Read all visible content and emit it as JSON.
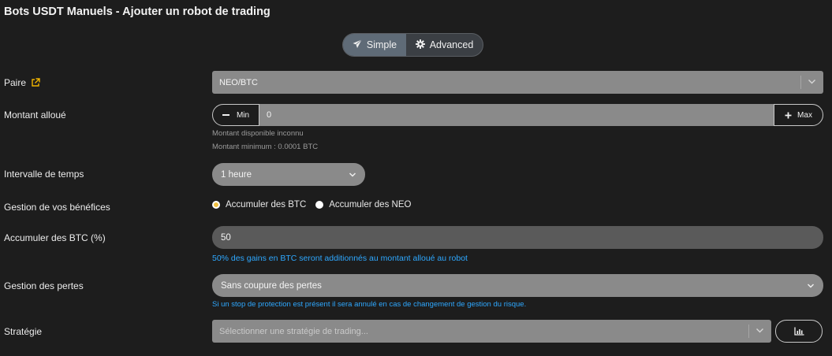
{
  "header": {
    "title": "Bots USDT Manuels - Ajouter un robot de trading"
  },
  "mode_switch": {
    "simple_label": "Simple",
    "advanced_label": "Advanced",
    "active": "simple"
  },
  "pair": {
    "label": "Paire",
    "value": "NEO/BTC"
  },
  "amount": {
    "label": "Montant alloué",
    "min_label": "Min",
    "value": "0",
    "max_label": "Max",
    "available_hint": "Montant disponible inconnu",
    "minimum_hint": "Montant minimum : 0.0001 BTC"
  },
  "interval": {
    "label": "Intervalle de temps",
    "value": "1 heure"
  },
  "profits": {
    "label": "Gestion de vos bénéfices",
    "options": [
      "Accumuler des BTC",
      "Accumuler des NEO"
    ],
    "selected": "Accumuler des BTC"
  },
  "accumulate": {
    "label": "Accumuler des BTC (%)",
    "value": "50",
    "info": "50% des gains en BTC seront additionnés au montant alloué au robot"
  },
  "losses": {
    "label": "Gestion des pertes",
    "value": "Sans coupure des pertes",
    "info": "Si un stop de protection est présent il sera annulé en cas de changement de gestion du risque."
  },
  "strategy": {
    "label": "Stratégie",
    "placeholder": "Sélectionner une stratégie de trading..."
  },
  "icons": {
    "simple": "paper-plane-icon",
    "advanced": "gear-icon",
    "external": "external-link-icon",
    "strategy_button": "bar-chart-icon"
  },
  "colors": {
    "accent_blue": "#2ea8ff",
    "radio_selected": "#f0c040",
    "external_link": "#f0b400"
  }
}
